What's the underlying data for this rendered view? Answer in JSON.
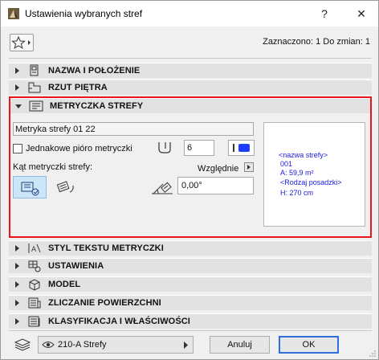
{
  "window": {
    "title": "Ustawienia wybranych stref"
  },
  "titlebar": {
    "help_label": "?",
    "close_label": "✕"
  },
  "header": {
    "selection_info": "Zaznaczono: 1 Do zmian: 1"
  },
  "panels": [
    {
      "label": "NAZWA I POŁOŻENIE",
      "icon": "name-position-icon",
      "expanded": false
    },
    {
      "label": "RZUT PIĘTRA",
      "icon": "floor-plan-icon",
      "expanded": false
    },
    {
      "label": "METRYCZKA STREFY",
      "icon": "zone-stamp-icon",
      "expanded": true
    },
    {
      "label": "STYL TEKSTU METRYCZKI",
      "icon": "text-style-icon",
      "expanded": false
    },
    {
      "label": "USTAWIENIA",
      "icon": "settings-icon",
      "expanded": false
    },
    {
      "label": "MODEL",
      "icon": "model-icon",
      "expanded": false
    },
    {
      "label": "ZLICZANIE POWIERZCHNI",
      "icon": "area-calculation-icon",
      "expanded": false
    },
    {
      "label": "KLASYFIKACJA I WŁAŚCIWOŚCI",
      "icon": "classification-icon",
      "expanded": false
    }
  ],
  "stamp": {
    "stamp_name": "Metryka strefy 01 22",
    "same_pen_label": "Jednakowe pióro metryczki",
    "same_pen_checked": false,
    "pen_value": "6",
    "pen_color": "#1f3cff",
    "angle_label": "Kąt metryczki strefy:",
    "relative_label": "Względnie",
    "angle_value": "0,00°"
  },
  "preview": {
    "lines": [
      "<nazwa strefy>",
      "001",
      "A: 59,9 m²",
      "<Rodzaj posadzki>",
      "H: 270 cm"
    ]
  },
  "footer": {
    "layer_value": "210-A Strefy",
    "cancel_label": "Anuluj",
    "ok_label": "OK"
  },
  "colors": {
    "highlight_frame": "#e8161b",
    "accent": "#2f6fdb"
  }
}
